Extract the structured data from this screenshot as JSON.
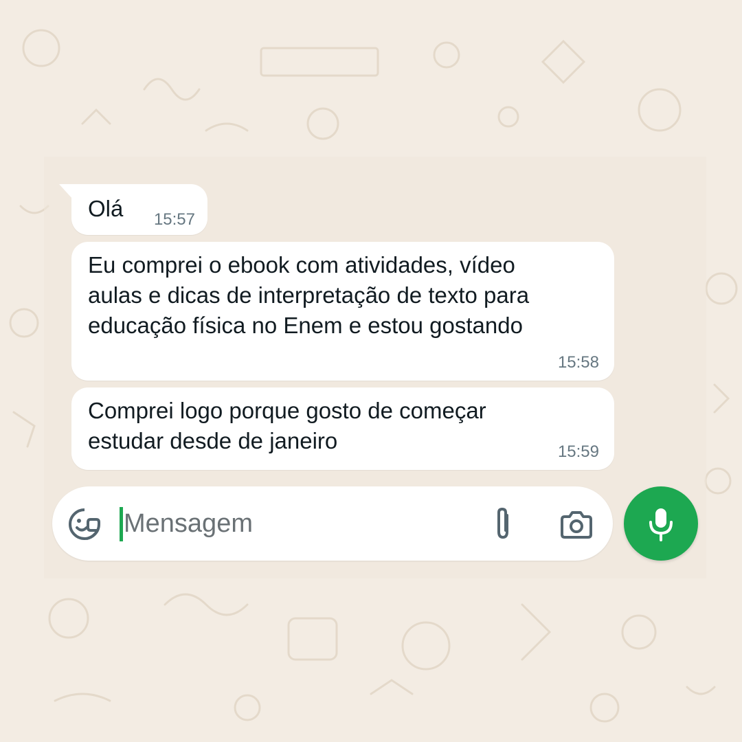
{
  "messages": [
    {
      "text": "Olá",
      "time": "15:57"
    },
    {
      "text": "Eu comprei o ebook com atividades, vídeo\naulas e dicas de interpretação de texto para\neducação física no Enem e estou gostando",
      "time": "15:58"
    },
    {
      "text": "Comprei logo porque gosto de começar\nestudar desde de janeiro",
      "time": "15:59"
    }
  ],
  "composer": {
    "placeholder": "Mensagem",
    "value": ""
  },
  "icons": {
    "emoji": "sticker-emoji-icon",
    "attach": "paperclip-icon",
    "camera": "camera-icon",
    "mic": "microphone-icon"
  },
  "colors": {
    "accent": "#1da851",
    "bubble": "#ffffff",
    "background": "#f3ece3",
    "timestamp": "#667781"
  }
}
